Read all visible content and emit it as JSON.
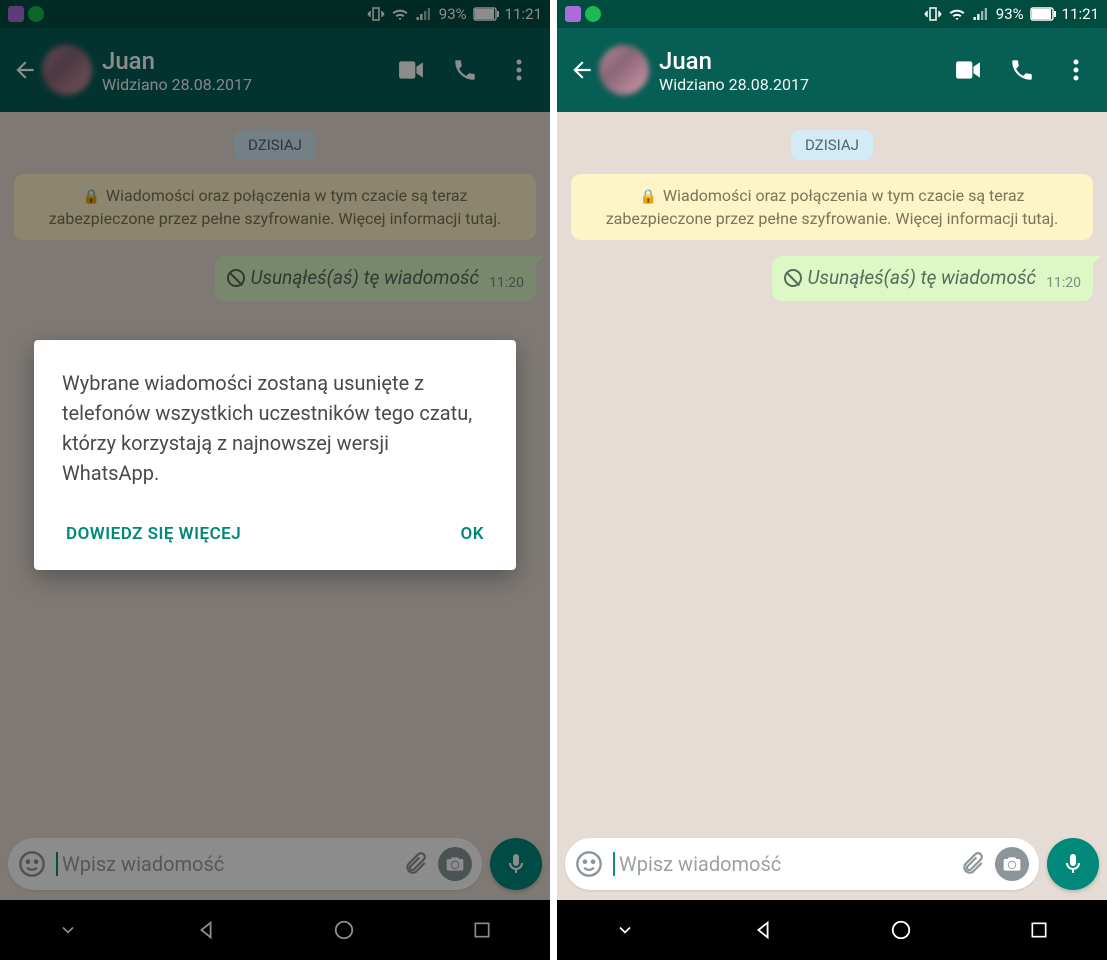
{
  "statusbar": {
    "battery": "93%",
    "time": "11:21"
  },
  "header": {
    "contact_name": "Juan",
    "last_seen": "Widziano 28.08.2017"
  },
  "chat": {
    "date_chip": "DZISIAJ",
    "encryption_notice": "Wiadomości oraz połączenia w tym czacie są teraz zabezpieczone przez pełne szyfrowanie. Więcej informacji tutaj.",
    "deleted_message": "Usunąłeś(aś) tę wiadomość",
    "deleted_message_time": "11:20"
  },
  "input": {
    "placeholder": "Wpisz wiadomość"
  },
  "dialog": {
    "body": "Wybrane wiadomości zostaną usunięte z telefonów wszystkich uczestników tego czatu, którzy korzystają z najnowszej wersji WhatsApp.",
    "learn_more": "DOWIEDZ SIĘ WIĘCEJ",
    "ok": "OK"
  }
}
